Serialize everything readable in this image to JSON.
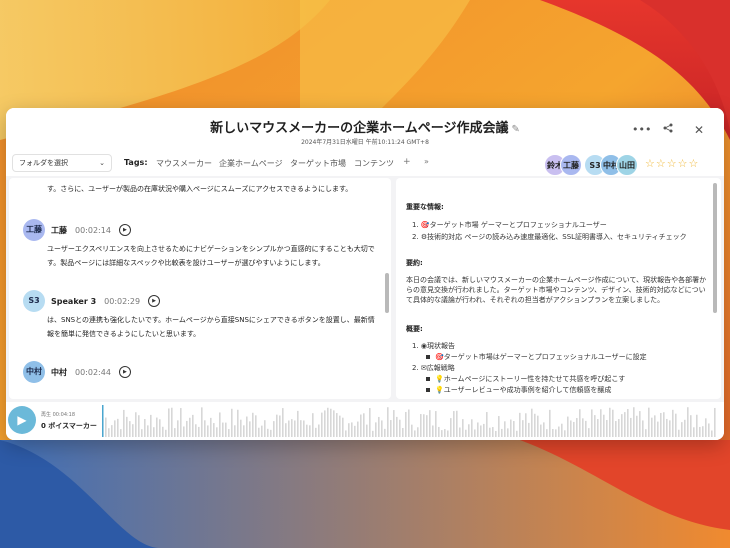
{
  "window": {
    "title": "新しいマウスメーカーの企業ホームページ作成会議",
    "edit_icon": "pencil-icon",
    "subtitle": "2024年7月31日水曜日 午前10:11:24 GMT+8",
    "actions": [
      "more-icon",
      "share-icon",
      "close-icon"
    ]
  },
  "toolbar": {
    "folder_select": "フォルダを選択",
    "tags_label": "Tags:",
    "tags": [
      "マウスメーカー",
      "企業ホームページ",
      "ターゲット市場",
      "コンテンツ"
    ],
    "add": "+",
    "more": "»",
    "avatars": [
      {
        "label": "鈴木",
        "color": "#c9bff0"
      },
      {
        "label": "工藤",
        "color": "#a9b8f0"
      },
      {
        "label": "S3",
        "color": "#b7dcf2"
      },
      {
        "label": "中村",
        "color": "#8fbfe8"
      },
      {
        "label": "山田",
        "color": "#9ed4e6"
      }
    ],
    "stars": "☆☆☆☆☆"
  },
  "transcript": {
    "intro": "す。さらに、ユーザーが製品の在庫状況や購入ページにスムーズにアクセスできるようにします。",
    "entries": [
      {
        "avatar": "工藤",
        "avatar_color": "#a9b8f0",
        "name": "工藤",
        "time": "00:02:14",
        "text": "ユーザーエクスペリエンスを向上させるためにナビゲーションをシンプルかつ直感的にすることも大切です。製品ページには詳細なスペックや比較表を設けユーザーが選びやすいようにします。"
      },
      {
        "avatar": "S3",
        "avatar_color": "#b7dcf2",
        "name": "Speaker 3",
        "time": "00:02:29",
        "text": "は、SNSとの連携も強化したいです。ホームページから直接SNSにシェアできるボタンを設置し、最新情報を簡単に発信できるようにしたいと思います。"
      },
      {
        "avatar": "中村",
        "avatar_color": "#8fbfe8",
        "name": "中村",
        "time": "00:02:44",
        "text": ""
      }
    ]
  },
  "summary": {
    "key_info_heading": "重要な情報:",
    "key_info": [
      "1. 🎯ターゲット市場 ゲーマーとプロフェッショナルユーザー",
      "2. ⚙技術的対応 ページの読み込み速度最適化、SSL証明書導入、セキュリティチェック"
    ],
    "abstract_heading": "要約:",
    "abstract": "本日の会議では、新しいマウスメーカーの企業ホームページ作成について、現状報告や各部署からの意見交換が行われました。ターゲット市場やコンテンツ、デザイン、技術的対応などについて具体的な議論が行われ、それぞれの担当者がアクションプランを立案しました。",
    "outline_heading": "概要:",
    "outline": [
      {
        "level": 1,
        "text": "1. ◉現状報告"
      },
      {
        "level": 2,
        "text": "🎯ターゲット市場はゲーマーとプロフェッショナルユーザーに設定"
      },
      {
        "level": 1,
        "text": "2. ✉広報戦略"
      },
      {
        "level": 2,
        "text": "💡ホームページにストーリー性を持たせて共感を呼び起こす"
      },
      {
        "level": 2,
        "text": "💡ユーザーレビューや成功事例を紹介して信頼感を醸成"
      }
    ]
  },
  "player": {
    "play_icon": "play-icon",
    "label": "再生 00:04:18",
    "marker": "0 ボイスマーカー",
    "progress": 0.0
  }
}
